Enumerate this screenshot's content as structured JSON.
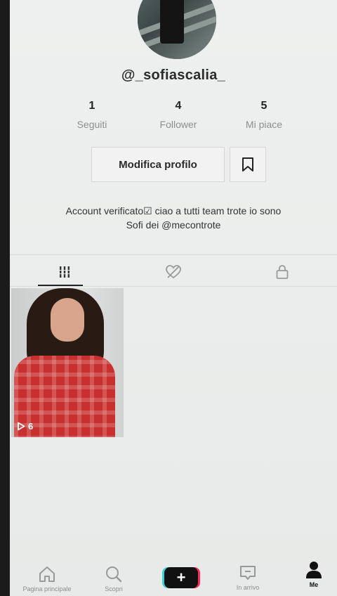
{
  "profile": {
    "username": "@_sofiascalia_",
    "bio_line1": "Account verificato☑  ciao a tutti team trote io sono",
    "bio_line2": "Sofi dei @mecontrote"
  },
  "stats": [
    {
      "value": "1",
      "label": "Seguiti"
    },
    {
      "value": "4",
      "label": "Follower"
    },
    {
      "value": "5",
      "label": "Mi piace"
    }
  ],
  "actions": {
    "edit_profile": "Modifica profilo",
    "bookmark_icon": "bookmark-icon"
  },
  "tabs": [
    {
      "icon": "grid-icon",
      "active": true
    },
    {
      "icon": "liked-hidden-icon",
      "active": false
    },
    {
      "icon": "lock-icon",
      "active": false
    }
  ],
  "videos": [
    {
      "views": "6",
      "icon": "play-icon"
    }
  ],
  "bottom_nav": [
    {
      "label": "Pagina principale",
      "icon": "home-icon"
    },
    {
      "label": "Scopri",
      "icon": "search-icon"
    },
    {
      "label": "",
      "icon": "plus-icon"
    },
    {
      "label": "In arrivo",
      "icon": "inbox-icon"
    },
    {
      "label": "Me",
      "icon": "profile-icon",
      "active": true
    }
  ],
  "colors": {
    "accent_cyan": "#3ad0d6",
    "accent_red": "#ff2a55",
    "text_dark": "#222222",
    "text_muted": "#8c8f8e"
  }
}
